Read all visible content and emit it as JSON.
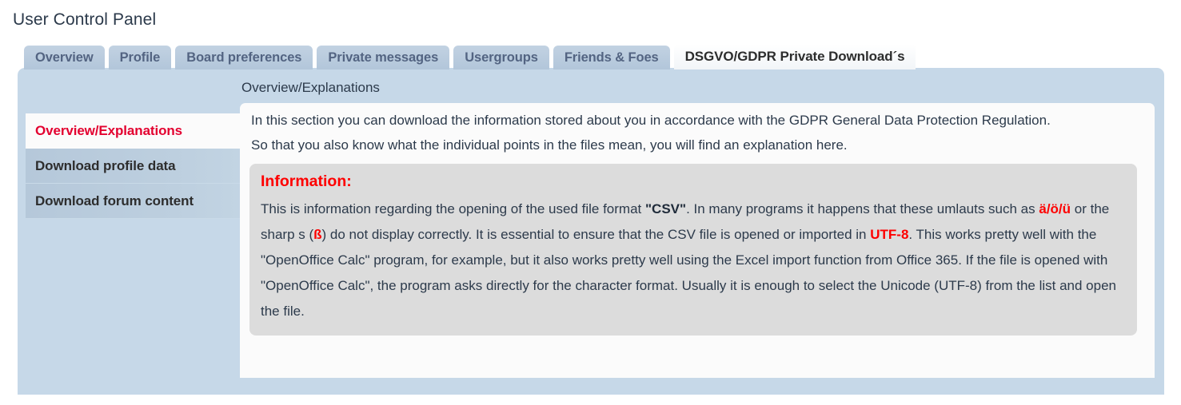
{
  "page": {
    "title": "User Control Panel"
  },
  "tabs": [
    {
      "label": "Overview",
      "active": false
    },
    {
      "label": "Profile",
      "active": false
    },
    {
      "label": "Board preferences",
      "active": false
    },
    {
      "label": "Private messages",
      "active": false
    },
    {
      "label": "Usergroups",
      "active": false
    },
    {
      "label": "Friends & Foes",
      "active": false
    },
    {
      "label": "DSGVO/GDPR Private Download´s",
      "active": true
    }
  ],
  "sidebar": {
    "items": [
      {
        "label": "Overview/Explanations",
        "active": true
      },
      {
        "label": "Download profile data",
        "active": false
      },
      {
        "label": "Download forum content",
        "active": false
      }
    ]
  },
  "content": {
    "heading": "Overview/Explanations",
    "paragraph1": "In this section you can download the information stored about you in accordance with the GDPR General Data Protection Regulation.",
    "paragraph2": "So that you also know what the individual points in the files mean, you will find an explanation here.",
    "infobox": {
      "title": "Information:",
      "text_part1": "This is information regarding the opening of the used file format ",
      "bold_csv": "\"CSV\"",
      "text_part2": ". In many programs it happens that these umlauts such as ",
      "red_umlauts": "ä/ö/ü",
      "text_part3": " or the sharp s (",
      "red_sharps": "ß",
      "text_part4": ") do not display correctly. It is essential to ensure that the CSV file is opened or imported in ",
      "red_utf8": "UTF-8",
      "text_part5": ". This works pretty well with the \"OpenOffice Calc\" program, for example, but it also works pretty well using the Excel import function from Office 365. If the file is opened with \"OpenOffice Calc\", the program asks directly for the character format. Usually it is enough to select the Unicode (UTF-8) from the list and open the file."
    }
  },
  "colors": {
    "panel_bg": "#c6d8e8",
    "tab_inactive_bg": "#b6c9dc",
    "tab_active_bg": "#fbfcfd",
    "content_bg": "#fbfbfb",
    "infobox_bg": "#dcdcdc",
    "accent_red": "#fe0000",
    "active_nav_red": "#e3002f",
    "text": "#2c3a4b"
  }
}
